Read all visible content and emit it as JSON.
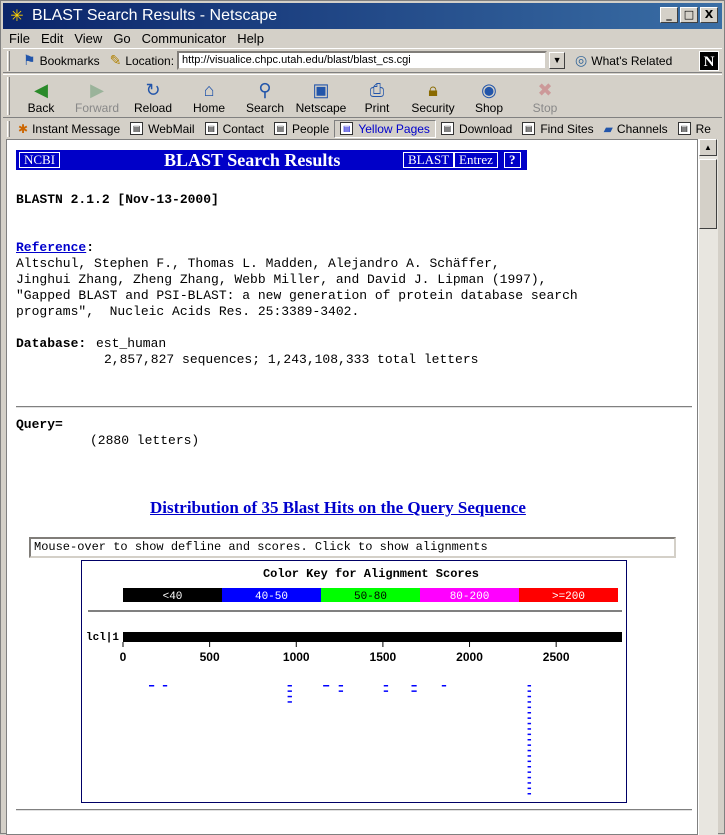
{
  "window": {
    "title": "BLAST Search Results - Netscape",
    "minimize": "_",
    "maximize": "□",
    "close": "X"
  },
  "menu": [
    "File",
    "Edit",
    "View",
    "Go",
    "Communicator",
    "Help"
  ],
  "location_bar": {
    "bookmarks_label": "Bookmarks",
    "location_label": "Location:",
    "url": "http://visualice.chpc.utah.edu/blast/blast_cs.cgi",
    "whats_related": "What's Related"
  },
  "nav_buttons": [
    "Back",
    "Forward",
    "Reload",
    "Home",
    "Search",
    "Netscape",
    "Print",
    "Security",
    "Shop",
    "Stop"
  ],
  "personal_toolbar": [
    "Instant Message",
    "WebMail",
    "Contact",
    "People",
    "Yellow Pages",
    "Download",
    "Find Sites",
    "Channels",
    "Re"
  ],
  "page": {
    "ncbi_label": "NCBI",
    "header_title": "BLAST Search Results",
    "blast_btn": "BLAST",
    "entrez_btn": "Entrez",
    "help_btn": "?",
    "version": "BLASTN 2.1.2 [Nov-13-2000]",
    "reference_label": "Reference",
    "reference_lines": [
      "Altschul, Stephen F., Thomas L. Madden, Alejandro A. Schäffer,",
      "Jinghui Zhang, Zheng Zhang, Webb Miller, and David J. Lipman (1997),",
      "\"Gapped BLAST and PSI-BLAST: a new generation of protein database search",
      "programs\",  Nucleic Acids Res. 25:3389-3402."
    ],
    "database_label": "Database:",
    "database_name": "est_human",
    "database_stats": "2,857,827 sequences; 1,243,108,333 total letters",
    "query_label": "Query=",
    "query_length": "(2880 letters)",
    "distribution_title": "Distribution of 35 Blast Hits on the Query Sequence",
    "mouseover_text": "Mouse-over to show defline and scores. Click to show alignments"
  },
  "chart_data": {
    "type": "bar",
    "title": "Color Key for Alignment Scores",
    "color_key": [
      {
        "label": "<40",
        "color": "#000000",
        "text": "#ffffff"
      },
      {
        "label": "40-50",
        "color": "#0000ff",
        "text": "#ffffff"
      },
      {
        "label": "50-80",
        "color": "#00ff00",
        "text": "#000000"
      },
      {
        "label": "80-200",
        "color": "#ff00ff",
        "text": "#ffffff"
      },
      {
        "label": ">=200",
        "color": "#ff0000",
        "text": "#ffffff"
      }
    ],
    "query_label": "lcl|1",
    "query_length": 2880,
    "xlim": [
      0,
      2880
    ],
    "ticks": [
      0,
      500,
      1000,
      1500,
      2000,
      2500
    ],
    "hits_color": "#0000ff",
    "hits": [
      {
        "start": 150,
        "end": 180,
        "row": 0
      },
      {
        "start": 230,
        "end": 255,
        "row": 0
      },
      {
        "start": 950,
        "end": 975,
        "row": 0
      },
      {
        "start": 950,
        "end": 975,
        "row": 1
      },
      {
        "start": 950,
        "end": 975,
        "row": 2
      },
      {
        "start": 950,
        "end": 975,
        "row": 3
      },
      {
        "start": 1155,
        "end": 1190,
        "row": 0
      },
      {
        "start": 1245,
        "end": 1270,
        "row": 0
      },
      {
        "start": 1245,
        "end": 1270,
        "row": 1
      },
      {
        "start": 1505,
        "end": 1530,
        "row": 0
      },
      {
        "start": 1505,
        "end": 1530,
        "row": 1
      },
      {
        "start": 1665,
        "end": 1695,
        "row": 0
      },
      {
        "start": 1665,
        "end": 1695,
        "row": 1
      },
      {
        "start": 1840,
        "end": 1865,
        "row": 0
      },
      {
        "start": 2335,
        "end": 2355,
        "row": 0
      },
      {
        "start": 2335,
        "end": 2355,
        "row": 1
      },
      {
        "start": 2335,
        "end": 2355,
        "row": 2
      },
      {
        "start": 2335,
        "end": 2355,
        "row": 3
      },
      {
        "start": 2335,
        "end": 2355,
        "row": 4
      },
      {
        "start": 2335,
        "end": 2355,
        "row": 5
      },
      {
        "start": 2335,
        "end": 2355,
        "row": 6
      },
      {
        "start": 2335,
        "end": 2355,
        "row": 7
      },
      {
        "start": 2335,
        "end": 2355,
        "row": 8
      },
      {
        "start": 2335,
        "end": 2355,
        "row": 9
      },
      {
        "start": 2335,
        "end": 2355,
        "row": 10
      },
      {
        "start": 2335,
        "end": 2355,
        "row": 11
      },
      {
        "start": 2335,
        "end": 2355,
        "row": 12
      },
      {
        "start": 2335,
        "end": 2355,
        "row": 13
      },
      {
        "start": 2335,
        "end": 2355,
        "row": 14
      },
      {
        "start": 2335,
        "end": 2355,
        "row": 15
      },
      {
        "start": 2335,
        "end": 2355,
        "row": 16
      },
      {
        "start": 2335,
        "end": 2355,
        "row": 17
      },
      {
        "start": 2335,
        "end": 2355,
        "row": 18
      },
      {
        "start": 2335,
        "end": 2355,
        "row": 19
      },
      {
        "start": 2335,
        "end": 2355,
        "row": 20
      }
    ]
  }
}
